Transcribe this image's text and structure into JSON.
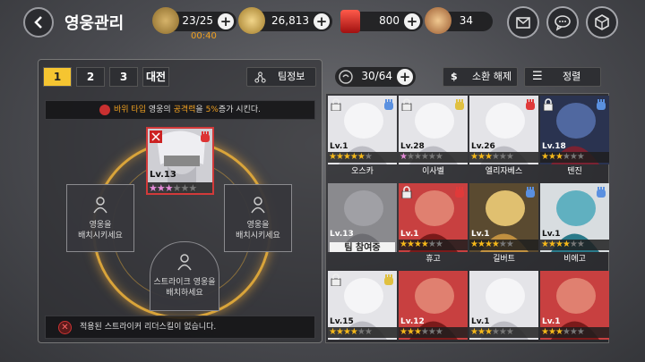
{
  "header": {
    "title": "영웅관리",
    "stamina": "23/25",
    "stamina_timer": "00:40",
    "gold": "26,813",
    "rubies": "800",
    "medals": "34"
  },
  "team_tabs": [
    "1",
    "2",
    "3",
    "대전"
  ],
  "team_info_label": "팀정보",
  "hero_count": "30/64",
  "summon_release_label": "소환 해제",
  "sort_label": "정렬",
  "bonus": {
    "prefix": "바위 타입",
    "middle": "영웅의",
    "stat": "공격력",
    "mid2": "을",
    "value": "5%",
    "suffix": "증가 시킨다."
  },
  "leader": {
    "level": "Lv.13",
    "stars": 3,
    "max_stars": 6
  },
  "empty_slot_label": "영웅을\n배치시키세요",
  "striker_slot_label": "스트라이크 영웅을\n배치하세요",
  "footer_message": "적용된 스트라이커 리더스킬이 없습니다.",
  "colors": {
    "accent": "#f5c531",
    "star": "#f5b81a",
    "danger": "#c93030"
  },
  "heroes": [
    {
      "level": "Lv.1",
      "name": "오스카",
      "stars": 5,
      "pink": false,
      "locked": true,
      "type": "paper",
      "theme": "light"
    },
    {
      "level": "Lv.28",
      "name": "이사벨",
      "stars": 1,
      "pink": true,
      "locked": true,
      "type": "scissors",
      "theme": "light"
    },
    {
      "level": "Lv.26",
      "name": "엘리자베스",
      "stars": 3,
      "pink": false,
      "locked": false,
      "type": "rock",
      "theme": "light"
    },
    {
      "level": "Lv.18",
      "name": "텐진",
      "stars": 3,
      "pink": false,
      "locked": true,
      "type": "paper",
      "theme": "dark"
    },
    {
      "level": "Lv.13",
      "name": "",
      "stars": 0,
      "pink": false,
      "locked": false,
      "type": "",
      "theme": "dim",
      "banner": "팀 참여중"
    },
    {
      "level": "Lv.1",
      "name": "휴고",
      "stars": 4,
      "pink": false,
      "locked": true,
      "type": "rock",
      "theme": "red"
    },
    {
      "level": "Lv.1",
      "name": "길버트",
      "stars": 4,
      "pink": false,
      "locked": false,
      "type": "paper",
      "theme": "gold"
    },
    {
      "level": "Lv.1",
      "name": "비에고",
      "stars": 4,
      "pink": false,
      "locked": false,
      "type": "paper",
      "theme": "teal"
    },
    {
      "level": "Lv.15",
      "name": "",
      "stars": 4,
      "pink": false,
      "locked": true,
      "type": "scissors",
      "theme": "light"
    },
    {
      "level": "Lv.12",
      "name": "",
      "stars": 3,
      "pink": false,
      "locked": false,
      "type": "",
      "theme": "red"
    },
    {
      "level": "Lv.1",
      "name": "",
      "stars": 3,
      "pink": false,
      "locked": false,
      "type": "",
      "theme": "light"
    },
    {
      "level": "Lv.1",
      "name": "",
      "stars": 3,
      "pink": false,
      "locked": false,
      "type": "",
      "theme": "red"
    }
  ]
}
